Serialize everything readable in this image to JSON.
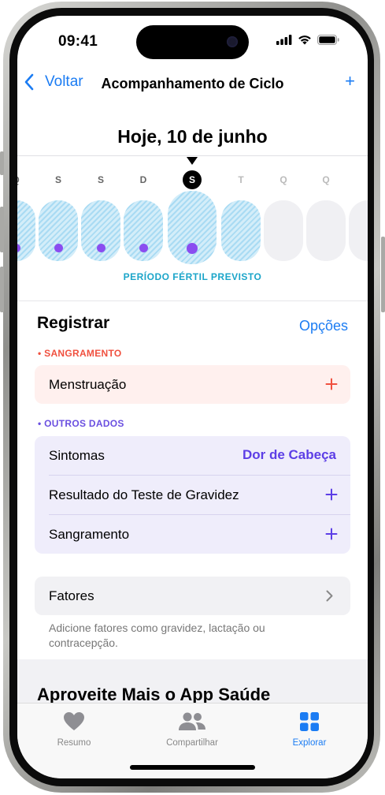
{
  "status": {
    "time": "09:41"
  },
  "nav": {
    "back_label": "Voltar",
    "title": "Acompanhamento de Ciclo",
    "add_label": "+"
  },
  "date_header": "Hoje, 10 de junho",
  "calendar": {
    "days": [
      {
        "letter": "Q",
        "state": "past",
        "fertile": true,
        "dot": true
      },
      {
        "letter": "S",
        "state": "past",
        "fertile": true,
        "dot": true
      },
      {
        "letter": "S",
        "state": "past",
        "fertile": true,
        "dot": true
      },
      {
        "letter": "D",
        "state": "past",
        "fertile": true,
        "dot": true
      },
      {
        "letter": "S",
        "state": "today",
        "fertile": true,
        "dot": true
      },
      {
        "letter": "T",
        "state": "future",
        "fertile": true,
        "dot": false
      },
      {
        "letter": "Q",
        "state": "future",
        "fertile": false,
        "dot": false
      },
      {
        "letter": "Q",
        "state": "future",
        "fertile": false,
        "dot": false
      },
      {
        "letter": "",
        "state": "future",
        "fertile": false,
        "dot": false
      }
    ],
    "fertile_label": "PERÍODO FÉRTIL PREVISTO"
  },
  "register": {
    "title": "Registrar",
    "options_label": "Opções",
    "bleeding_section": "• SANGRAMENTO",
    "menstruation_label": "Menstruação",
    "other_section": "• OUTROS DADOS",
    "rows": [
      {
        "label": "Sintomas",
        "value": "Dor de Cabeça"
      },
      {
        "label": "Resultado do Teste de Gravidez",
        "value": "+"
      },
      {
        "label": "Sangramento",
        "value": "+"
      }
    ],
    "factors_label": "Fatores",
    "factors_note": "Adicione fatores como gravidez, lactação ou contracepção."
  },
  "promo_title": "Aproveite Mais o App Saúde",
  "tabbar": {
    "tabs": [
      {
        "label": "Resumo",
        "icon": "heart-icon"
      },
      {
        "label": "Compartilhar",
        "icon": "people-icon"
      },
      {
        "label": "Explorar",
        "icon": "grid-icon"
      }
    ]
  },
  "colors": {
    "accent": "#1b7cf3",
    "bleeding": "#f0503f",
    "bleeding_bg": "#fff0ee",
    "other": "#6a4fe0",
    "other_bg": "#efedfb",
    "fertile": "#1ba5c9",
    "dot": "#8a4df0"
  }
}
